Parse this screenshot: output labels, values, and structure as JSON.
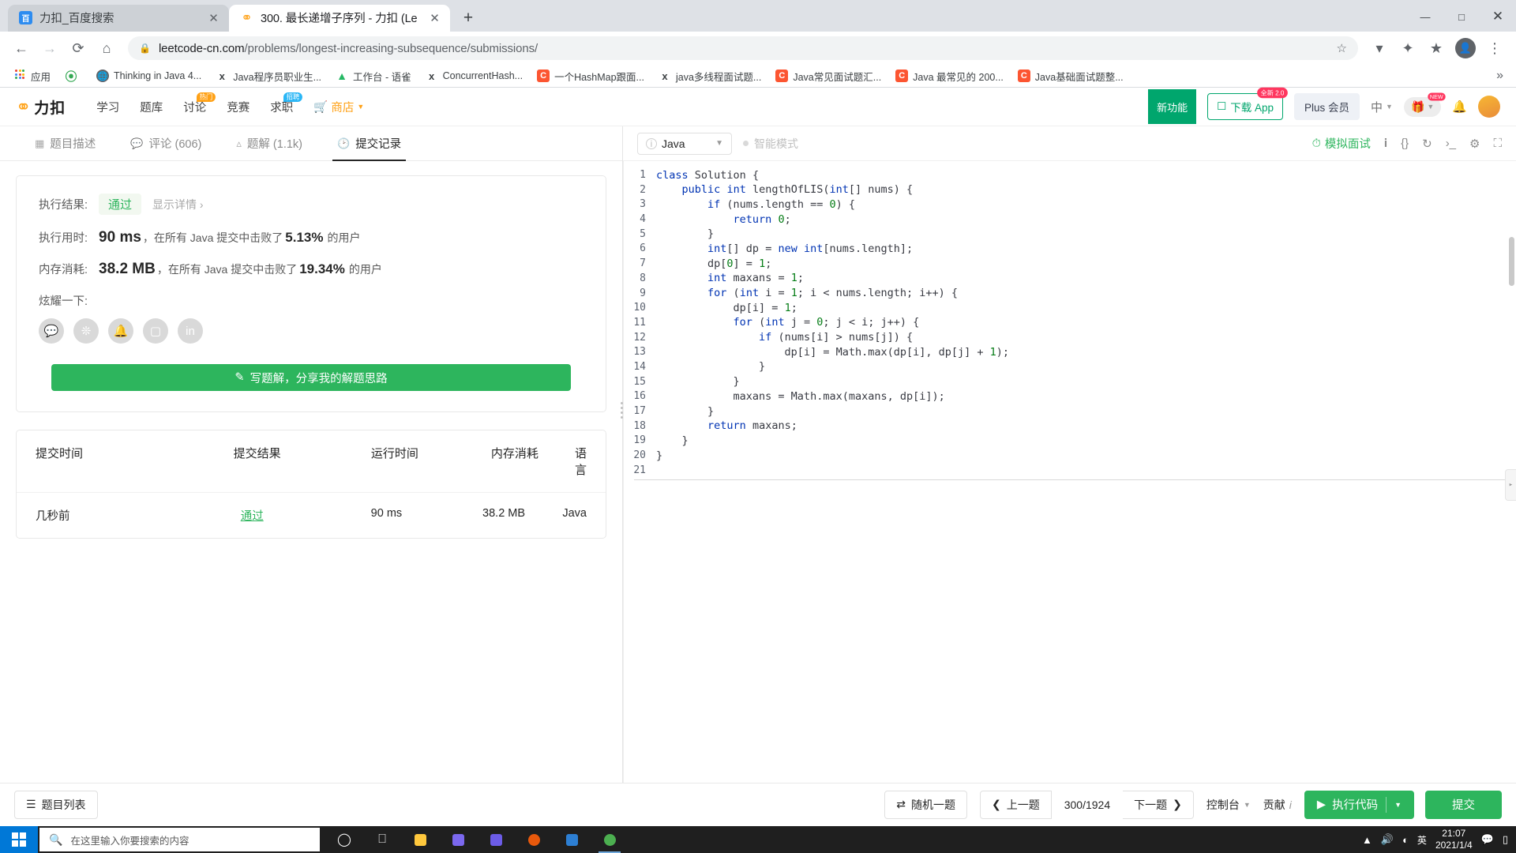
{
  "browser": {
    "tabs": [
      {
        "title": "力扣_百度搜索",
        "favicon": "baidu-icon",
        "active": false
      },
      {
        "title": "300. 最长递增子序列 - 力扣 (Le",
        "favicon": "leetcode-icon",
        "active": true
      }
    ],
    "new_tab_label": "+",
    "window_controls": {
      "minimize": "—",
      "maximize": "□",
      "close": "✕"
    },
    "nav": {
      "back": "←",
      "forward": "→",
      "reload": "⟳",
      "home": "⌂"
    },
    "omnibox": {
      "lock_icon": "lock-icon",
      "url_domain": "leetcode-cn.com",
      "url_path": "/problems/longest-increasing-subsequence/submissions/",
      "star_icon": "☆"
    },
    "toolbar_icons": [
      "shield-icon",
      "extensions-icon",
      "star-icon",
      "profile-icon",
      "menu-icon"
    ],
    "bookmarks": [
      {
        "label": "应用",
        "icon": "apps-grid-icon",
        "color": "#4285f4"
      },
      {
        "label": "",
        "icon": "leaf-icon",
        "color": "#34a853"
      },
      {
        "label": "Thinking in Java 4...",
        "icon": "globe-icon",
        "color": "#5f6368"
      },
      {
        "label": "Java程序员职业生...",
        "icon": "q-icon",
        "color": "#3c4043"
      },
      {
        "label": "工作台 - 语雀",
        "icon": "yuque-icon",
        "color": "#25b864"
      },
      {
        "label": "ConcurrentHash...",
        "icon": "q-icon",
        "color": "#3c4043"
      },
      {
        "label": "一个HashMap跟面...",
        "icon": "csdn-icon",
        "color": "#fc5531"
      },
      {
        "label": "java多线程面试题...",
        "icon": "q-icon",
        "color": "#3c4043"
      },
      {
        "label": "Java常见面试题汇...",
        "icon": "csdn-icon",
        "color": "#fc5531"
      },
      {
        "label": "Java 最常见的 200...",
        "icon": "csdn-icon",
        "color": "#fc5531"
      },
      {
        "label": "Java基础面试题整...",
        "icon": "csdn-icon",
        "color": "#fc5531"
      }
    ],
    "bookmarks_overflow": "»"
  },
  "site_nav": {
    "logo_text": "力扣",
    "links": [
      {
        "label": "学习",
        "badge": null
      },
      {
        "label": "题库",
        "badge": null
      },
      {
        "label": "讨论",
        "badge": "热门"
      },
      {
        "label": "竞赛",
        "badge": null
      },
      {
        "label": "求职",
        "badge": "招聘"
      },
      {
        "label": "商店",
        "badge": null,
        "accent": true
      }
    ],
    "new_feature_label": "新功能",
    "download_app": {
      "label": "下载 App",
      "badge": "全新 2.0"
    },
    "plus_member_label": "Plus 会员",
    "language": "中",
    "notification_badge": "NEW"
  },
  "tabs": [
    {
      "label": "题目描述",
      "icon": "document-icon",
      "active": false
    },
    {
      "label": "评论 (606)",
      "icon": "comment-icon",
      "active": false
    },
    {
      "label": "题解 (1.1k)",
      "icon": "bulb-icon",
      "active": false
    },
    {
      "label": "提交记录",
      "icon": "clock-icon",
      "active": true
    }
  ],
  "result": {
    "status_label": "执行结果:",
    "status_value": "通过",
    "detail_link": "显示详情 ›",
    "runtime_label": "执行用时:",
    "runtime_value": "90 ms",
    "runtime_text": "，在所有 Java 提交中击败了",
    "runtime_percent": "5.13%",
    "runtime_suffix": "的用户",
    "memory_label": "内存消耗:",
    "memory_value": "38.2 MB",
    "memory_text": "，在所有 Java 提交中击败了",
    "memory_percent": "19.34%",
    "memory_suffix": "的用户",
    "share_label": "炫耀一下:",
    "share_icons": [
      "wechat-icon",
      "weibo-icon",
      "qq-icon",
      "twitter-icon",
      "linkedin-icon"
    ],
    "write_solution_button": "写题解，分享我的解题思路",
    "write_solution_icon": "pencil-icon"
  },
  "submissions_table": {
    "headers": [
      "提交时间",
      "提交结果",
      "运行时间",
      "内存消耗",
      "语言"
    ],
    "rows": [
      {
        "time": "几秒前",
        "result": "通过",
        "runtime": "90 ms",
        "memory": "38.2 MB",
        "language": "Java"
      }
    ]
  },
  "editor": {
    "language": "Java",
    "language_info_icon": "info-icon",
    "smart_mode_label": "智能模式",
    "mock_interview_label": "模拟面试",
    "mock_icon": "clock-icon",
    "toolbar_icons": [
      "info-icon",
      "braces-icon",
      "reset-icon",
      "terminal-icon",
      "settings-icon",
      "fullscreen-icon"
    ],
    "code_lines": [
      {
        "n": 1,
        "tokens": [
          [
            "k",
            "class"
          ],
          [
            "t",
            " "
          ],
          [
            "fn",
            "Solution"
          ],
          [
            "t",
            " {"
          ]
        ]
      },
      {
        "n": 2,
        "tokens": [
          [
            "t",
            "    "
          ],
          [
            "k",
            "public"
          ],
          [
            "t",
            " "
          ],
          [
            "k",
            "int"
          ],
          [
            "t",
            " lengthOfLIS("
          ],
          [
            "k",
            "int"
          ],
          [
            "t",
            "[] nums) {"
          ]
        ]
      },
      {
        "n": 3,
        "tokens": [
          [
            "t",
            "        "
          ],
          [
            "k",
            "if"
          ],
          [
            "t",
            " (nums.length == "
          ],
          [
            "nm",
            "0"
          ],
          [
            "t",
            ") {"
          ]
        ]
      },
      {
        "n": 4,
        "tokens": [
          [
            "t",
            "            "
          ],
          [
            "k",
            "return"
          ],
          [
            "t",
            " "
          ],
          [
            "nm",
            "0"
          ],
          [
            "t",
            ";"
          ]
        ]
      },
      {
        "n": 5,
        "tokens": [
          [
            "t",
            "        }"
          ]
        ]
      },
      {
        "n": 6,
        "tokens": [
          [
            "t",
            "        "
          ],
          [
            "k",
            "int"
          ],
          [
            "t",
            "[] dp = "
          ],
          [
            "k",
            "new"
          ],
          [
            "t",
            " "
          ],
          [
            "k",
            "int"
          ],
          [
            "t",
            "[nums.length];"
          ]
        ]
      },
      {
        "n": 7,
        "tokens": [
          [
            "t",
            "        dp["
          ],
          [
            "nm",
            "0"
          ],
          [
            "t",
            "] = "
          ],
          [
            "nm",
            "1"
          ],
          [
            "t",
            ";"
          ]
        ]
      },
      {
        "n": 8,
        "tokens": [
          [
            "t",
            "        "
          ],
          [
            "k",
            "int"
          ],
          [
            "t",
            " maxans = "
          ],
          [
            "nm",
            "1"
          ],
          [
            "t",
            ";"
          ]
        ]
      },
      {
        "n": 9,
        "tokens": [
          [
            "t",
            "        "
          ],
          [
            "k",
            "for"
          ],
          [
            "t",
            " ("
          ],
          [
            "k",
            "int"
          ],
          [
            "t",
            " i = "
          ],
          [
            "nm",
            "1"
          ],
          [
            "t",
            "; i < nums.length; i++) {"
          ]
        ]
      },
      {
        "n": 10,
        "tokens": [
          [
            "t",
            "            dp[i] = "
          ],
          [
            "nm",
            "1"
          ],
          [
            "t",
            ";"
          ]
        ]
      },
      {
        "n": 11,
        "tokens": [
          [
            "t",
            "            "
          ],
          [
            "k",
            "for"
          ],
          [
            "t",
            " ("
          ],
          [
            "k",
            "int"
          ],
          [
            "t",
            " j = "
          ],
          [
            "nm",
            "0"
          ],
          [
            "t",
            "; j < i; j++) {"
          ]
        ]
      },
      {
        "n": 12,
        "tokens": [
          [
            "t",
            "                "
          ],
          [
            "k",
            "if"
          ],
          [
            "t",
            " (nums[i] > nums[j]) {"
          ]
        ]
      },
      {
        "n": 13,
        "tokens": [
          [
            "t",
            "                    dp[i] = Math.max(dp[i], dp[j] + "
          ],
          [
            "nm",
            "1"
          ],
          [
            "t",
            ");"
          ]
        ]
      },
      {
        "n": 14,
        "tokens": [
          [
            "t",
            "                }"
          ]
        ]
      },
      {
        "n": 15,
        "tokens": [
          [
            "t",
            "            }"
          ]
        ]
      },
      {
        "n": 16,
        "tokens": [
          [
            "t",
            "            maxans = Math.max(maxans, dp[i]);"
          ]
        ]
      },
      {
        "n": 17,
        "tokens": [
          [
            "t",
            "        }"
          ]
        ]
      },
      {
        "n": 18,
        "tokens": [
          [
            "t",
            "        "
          ],
          [
            "k",
            "return"
          ],
          [
            "t",
            " maxans;"
          ]
        ]
      },
      {
        "n": 19,
        "tokens": [
          [
            "t",
            "    }"
          ]
        ]
      },
      {
        "n": 20,
        "tokens": [
          [
            "t",
            "}"
          ]
        ]
      },
      {
        "n": 21,
        "tokens": [
          [
            "t",
            ""
          ]
        ]
      }
    ]
  },
  "bottom_bar": {
    "problem_list": "题目列表",
    "problem_list_icon": "list-icon",
    "random": "随机一题",
    "random_icon": "shuffle-icon",
    "prev": "上一题",
    "next": "下一题",
    "counter": "300/1924",
    "console": "控制台",
    "contribute": "贡献",
    "run_code": "执行代码",
    "submit": "提交"
  },
  "taskbar": {
    "search_placeholder": "在这里输入你要搜索的内容",
    "search_icon": "search-icon",
    "icons": [
      "cortana-icon",
      "taskview-icon",
      "explorer-icon",
      "store-icon",
      "app-icon",
      "firefox-icon",
      "vscode-icon",
      "chrome-icon"
    ],
    "tray_icons": [
      "chevron-up-icon",
      "volume-icon",
      "network-icon"
    ],
    "ime": "英",
    "time": "21:07",
    "date": "2021/1/4",
    "notification_icon": "notification-icon"
  },
  "colors": {
    "green": "#2db55d",
    "orange": "#ffa116",
    "blue": "#0033b3",
    "chrome_tabstrip": "#dee1e6"
  }
}
